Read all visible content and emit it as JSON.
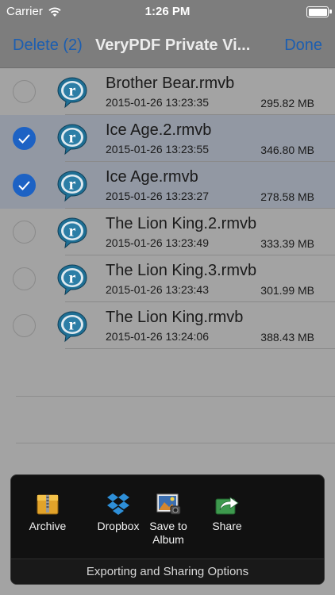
{
  "status_bar": {
    "carrier": "Carrier",
    "time": "1:26 PM",
    "battery_level": 1.0
  },
  "nav": {
    "left_label": "Delete (2)",
    "title": "VeryPDF Private Vi...",
    "right_label": "Done"
  },
  "files": [
    {
      "name": "Brother Bear.rmvb",
      "date": "2015-01-26 13:23:35",
      "size": "295.82 MB",
      "selected": false
    },
    {
      "name": "Ice Age.2.rmvb",
      "date": "2015-01-26 13:23:55",
      "size": "346.80 MB",
      "selected": true
    },
    {
      "name": "Ice Age.rmvb",
      "date": "2015-01-26 13:23:27",
      "size": "278.58 MB",
      "selected": true
    },
    {
      "name": "The Lion King.2.rmvb",
      "date": "2015-01-26 13:23:49",
      "size": "333.39 MB",
      "selected": false
    },
    {
      "name": "The Lion King.3.rmvb",
      "date": "2015-01-26 13:23:43",
      "size": "301.99 MB",
      "selected": false
    },
    {
      "name": "The Lion King.rmvb",
      "date": "2015-01-26 13:24:06",
      "size": "388.43 MB",
      "selected": false
    }
  ],
  "sheet": {
    "actions": [
      {
        "label": "Archive",
        "icon": "archive-icon"
      },
      {
        "label": "Dropbox",
        "icon": "dropbox-icon"
      },
      {
        "label": "Save to Album",
        "icon": "photo-album-icon"
      },
      {
        "label": "Share",
        "icon": "share-icon"
      }
    ],
    "footer": "Exporting and Sharing Options"
  },
  "colors": {
    "accent": "#1d62c4",
    "nav_bg": "#7d7d7d",
    "selected_row": "#9298a3",
    "sheet_bg": "#111111"
  }
}
